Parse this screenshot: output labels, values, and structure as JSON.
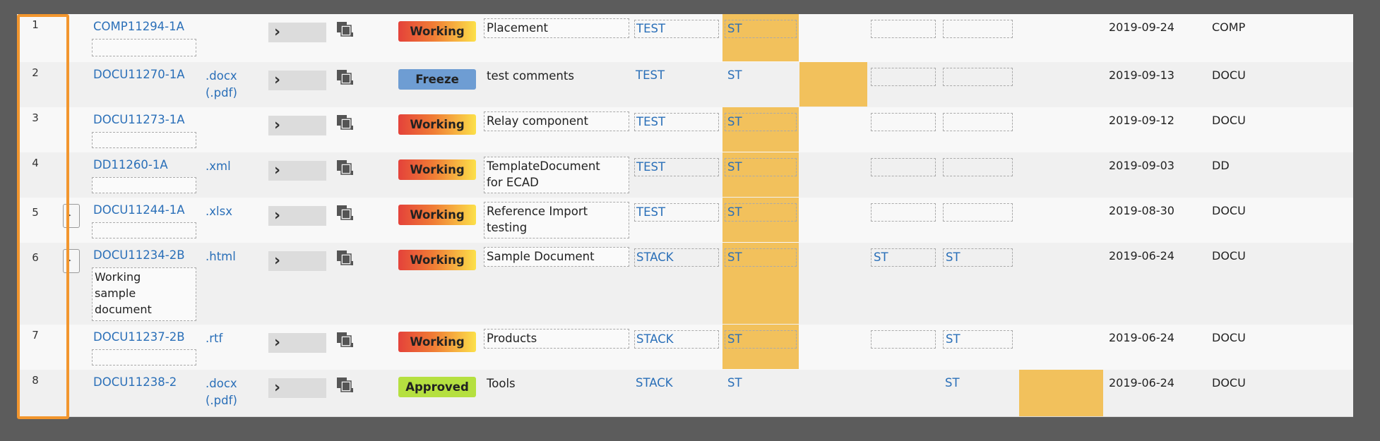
{
  "grid": {
    "expand_arrow": "›",
    "rows": [
      {
        "num": "1",
        "id": "COMP11294-1A",
        "ext": "",
        "ext2": "",
        "status": "Working",
        "description": "Placement",
        "description2": "",
        "project": "TEST",
        "st_a": "ST",
        "st_b": "",
        "st_c": "",
        "date": "2019-09-24",
        "type": "COMP",
        "note": ""
      },
      {
        "num": "2",
        "id": "DOCU11270-1A",
        "ext": ".docx",
        "ext2": "(.pdf)",
        "status": "Freeze",
        "description": "test comments",
        "description2": "",
        "project": "TEST",
        "st_a": "ST",
        "st_b": "",
        "st_c": "",
        "date": "2019-09-13",
        "type": "DOCU",
        "note": ""
      },
      {
        "num": "3",
        "id": "DOCU11273-1A",
        "ext": "",
        "ext2": "",
        "status": "Working",
        "description": "Relay component",
        "description2": "",
        "project": "TEST",
        "st_a": "ST",
        "st_b": "",
        "st_c": "",
        "date": "2019-09-12",
        "type": "DOCU",
        "note": ""
      },
      {
        "num": "4",
        "id": "DD11260-1A",
        "ext": ".xml",
        "ext2": "",
        "status": "Working",
        "description": "TemplateDocument",
        "description2": "for ECAD",
        "project": "TEST",
        "st_a": "ST",
        "st_b": "",
        "st_c": "",
        "date": "2019-09-03",
        "type": "DD",
        "note": ""
      },
      {
        "num": "5",
        "id": "DOCU11244-1A",
        "ext": ".xlsx",
        "ext2": "",
        "status": "Working",
        "description": "Reference Import",
        "description2": "testing",
        "project": "TEST",
        "st_a": "ST",
        "st_b": "",
        "st_c": "",
        "date": "2019-08-30",
        "type": "DOCU",
        "note": ""
      },
      {
        "num": "6",
        "id": "DOCU11234-2B",
        "ext": ".html",
        "ext2": "",
        "status": "Working",
        "description": "Sample Document",
        "description2": "",
        "project": "STACK",
        "st_a": "ST",
        "st_b": "ST",
        "st_c": "ST",
        "date": "2019-06-24",
        "type": "DOCU",
        "note": [
          "Working",
          "sample",
          "document"
        ]
      },
      {
        "num": "7",
        "id": "DOCU11237-2B",
        "ext": ".rtf",
        "ext2": "",
        "status": "Working",
        "description": "Products",
        "description2": "",
        "project": "STACK",
        "st_a": "ST",
        "st_b": "",
        "st_c": "ST",
        "date": "2019-06-24",
        "type": "DOCU",
        "note": ""
      },
      {
        "num": "8",
        "id": "DOCU11238-2",
        "ext": ".docx",
        "ext2": "(.pdf)",
        "status": "Approved",
        "description": "Tools",
        "description2": "",
        "project": "STACK",
        "st_a": "ST",
        "st_b": "",
        "st_c": "ST",
        "date": "2019-06-24",
        "type": "DOCU",
        "note": ""
      }
    ]
  },
  "colors": {
    "working": "#f07c35",
    "freeze": "#6e9dd3",
    "approved": "#b5e040",
    "highlight": "#f2c15c",
    "selection": "#f2962e",
    "link": "#2a6fb8"
  },
  "icons": {
    "expand": "chevron-right-icon",
    "copy": "copy-icon",
    "expander": "row-expander-icon"
  }
}
